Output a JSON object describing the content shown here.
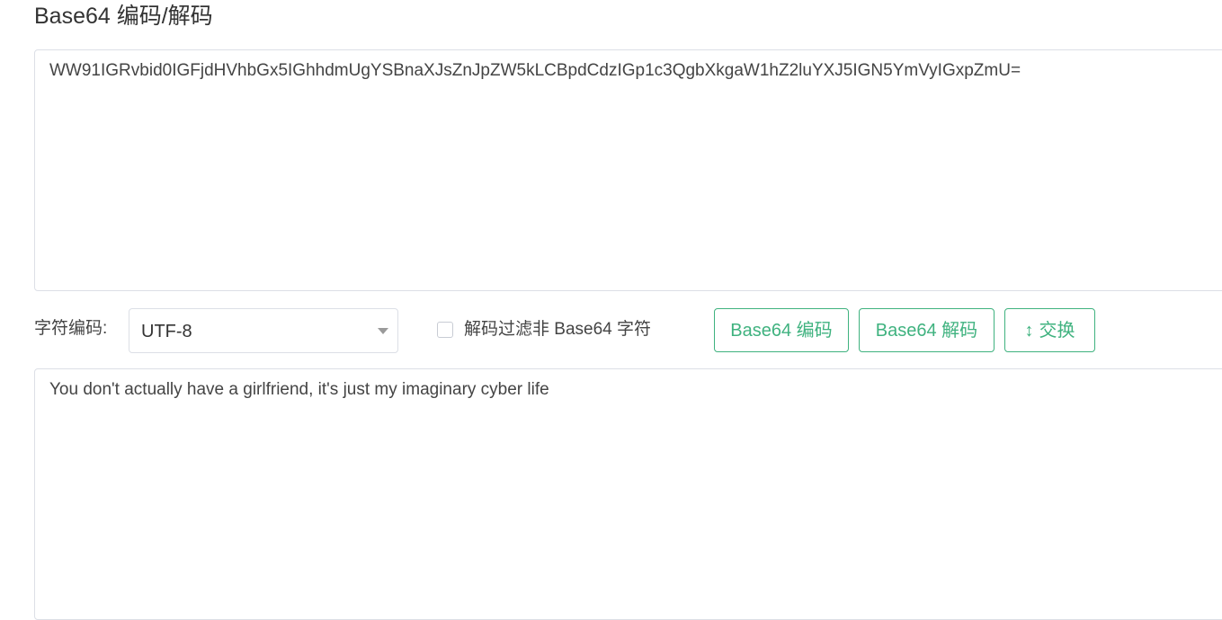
{
  "page": {
    "title": "Base64 编码/解码"
  },
  "input": {
    "value": "WW91IGRvbid0IGFjdHVhbGx5IGhhdmUgYSBnaXJsZnJpZW5kLCBpdCdzIGp1c3QgbXkgaW1hZ2luYXJ5IGN5YmVyIGxpZmU="
  },
  "controls": {
    "charset_label": "字符编码:",
    "charset_value": "UTF-8",
    "filter_label": "解码过滤非 Base64 字符",
    "filter_checked": false,
    "encode_label": "Base64 编码",
    "decode_label": "Base64 解码",
    "swap_icon": "↕",
    "swap_label": "交换",
    "accent_color": "#3fb27f"
  },
  "output": {
    "value": "You don't actually have a girlfriend, it's just my imaginary cyber life"
  }
}
